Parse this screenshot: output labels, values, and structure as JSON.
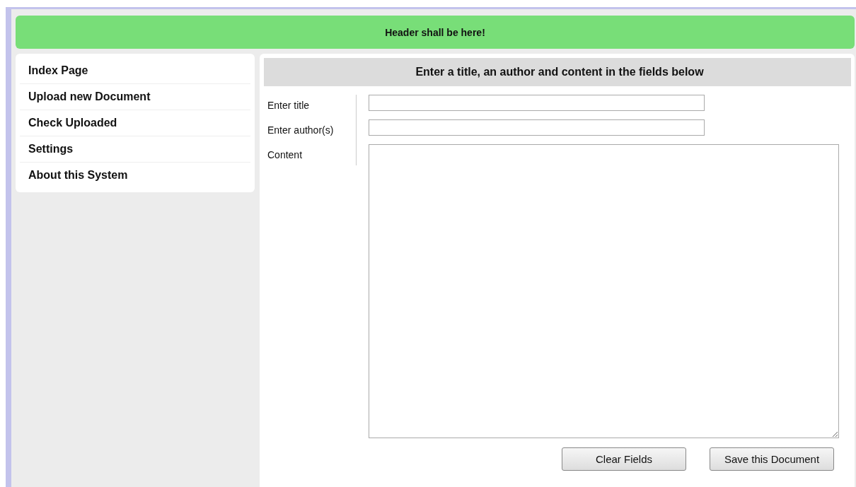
{
  "header": {
    "title": "Header shall be here!"
  },
  "sidebar": {
    "items": [
      {
        "label": "Index Page"
      },
      {
        "label": "Upload new Document"
      },
      {
        "label": "Check Uploaded"
      },
      {
        "label": "Settings"
      },
      {
        "label": "About this System"
      }
    ]
  },
  "form": {
    "title": "Enter a title, an author and content in the fields below",
    "fields": [
      {
        "label": "Enter title",
        "kind": "text"
      },
      {
        "label": "Enter author(s)",
        "kind": "text"
      },
      {
        "label": "Content",
        "kind": "textarea"
      }
    ],
    "buttons": [
      {
        "label": "Clear Fields"
      },
      {
        "label": "Save this Document"
      }
    ]
  }
}
